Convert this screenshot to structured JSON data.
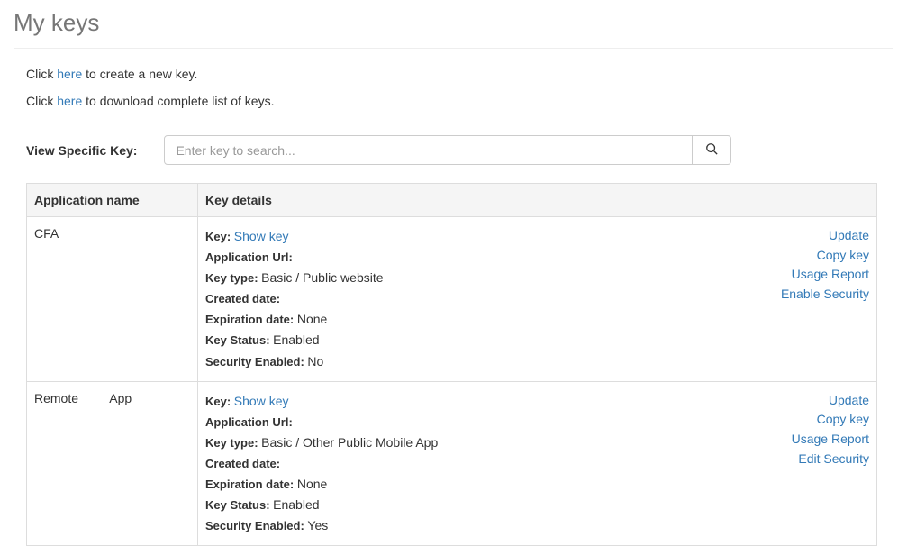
{
  "pageTitle": "My keys",
  "intro": {
    "click1_prefix": "Click ",
    "click1_link": "here",
    "click1_suffix": " to create a new key.",
    "click2_prefix": "Click ",
    "click2_link": "here",
    "click2_suffix": " to download complete list of keys."
  },
  "search": {
    "label": "View Specific Key:",
    "placeholder": "Enter key to search..."
  },
  "table": {
    "headers": {
      "app": "Application name",
      "details": "Key details"
    },
    "labels": {
      "key": "Key:",
      "appUrl": "Application Url:",
      "keyType": "Key type:",
      "created": "Created date:",
      "expiration": "Expiration date:",
      "status": "Key Status:",
      "security": "Security Enabled:"
    },
    "showKey": "Show key",
    "rows": [
      {
        "appName": "CFA",
        "appUrl": "",
        "keyType": "Basic / Public website",
        "created": "",
        "expiration": "None",
        "status": "Enabled",
        "security": "No",
        "actions": [
          "Update",
          "Copy key",
          "Usage Report",
          "Enable Security"
        ]
      },
      {
        "appName": "Remote         App",
        "appUrl": "",
        "keyType": "Basic / Other Public Mobile App",
        "created": "",
        "expiration": "None",
        "status": "Enabled",
        "security": "Yes",
        "actions": [
          "Update",
          "Copy key",
          "Usage Report",
          "Edit Security"
        ]
      }
    ]
  }
}
